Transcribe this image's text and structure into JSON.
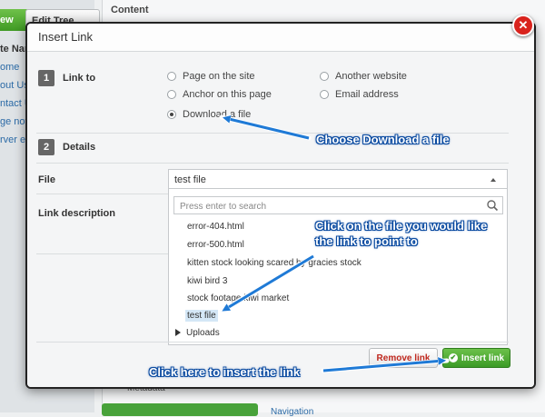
{
  "background": {
    "new_button": "ew",
    "edit_tree_button": "Edit Tree",
    "content_label": "Content",
    "site_tree": {
      "heading": "te Nar",
      "items": [
        "ome",
        "out Us",
        "ntact U",
        "ge not",
        "rver er"
      ]
    },
    "metadata_label": "Metadata",
    "bottom_link": "Navigation"
  },
  "dialog": {
    "title": "Insert Link",
    "close_icon": "close-icon",
    "step1": {
      "number": "1",
      "label": "Link to"
    },
    "step2": {
      "number": "2",
      "label": "Details"
    },
    "link_options": [
      {
        "label": "Page on the site",
        "checked": false
      },
      {
        "label": "Another website",
        "checked": false
      },
      {
        "label": "Anchor on this page",
        "checked": false
      },
      {
        "label": "Email address",
        "checked": false
      },
      {
        "label": "Download a file",
        "checked": true
      }
    ],
    "file_field": {
      "label": "File",
      "value": "test file",
      "search_placeholder": "Press enter to search",
      "options": [
        "error-404.html",
        "error-500.html",
        "kitten stock looking scared by gracies stock",
        "kiwi bird 3",
        "stock footage kiwi market",
        "test file"
      ],
      "selected": "test file",
      "folder": "Uploads"
    },
    "link_description_label": "Link description",
    "remove_link_button": "Remove link",
    "insert_link_button": "Insert link"
  },
  "annotations": {
    "choose": "Choose Download a file",
    "click_file_line1": "Click on the file you would like",
    "click_file_line2": "the link to point to",
    "click_insert": "Click here to insert the link"
  },
  "colors": {
    "annotation_arrow": "#1f7ad6",
    "insert_button": "#3b9a26",
    "remove_text": "#c0281e"
  }
}
